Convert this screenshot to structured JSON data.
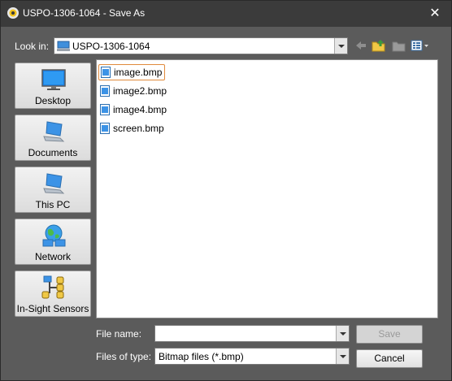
{
  "window": {
    "title": "USPO-1306-1064 - Save As",
    "close_glyph": "✕"
  },
  "toolbar": {
    "look_in_label": "Look in:",
    "look_in_value": "USPO-1306-1064",
    "icons": [
      "back-arrow-icon",
      "up-folder-icon",
      "new-folder-icon",
      "view-menu-icon"
    ]
  },
  "places": [
    {
      "label": "Desktop",
      "icon": "desktop-icon"
    },
    {
      "label": "Documents",
      "icon": "documents-computer-icon"
    },
    {
      "label": "This PC",
      "icon": "this-pc-icon"
    },
    {
      "label": "Network",
      "icon": "network-icon"
    },
    {
      "label": "In-Sight Sensors",
      "icon": "in-sight-sensors-icon"
    }
  ],
  "files": [
    {
      "name": "image.bmp",
      "selected": true
    },
    {
      "name": "image2.bmp",
      "selected": false
    },
    {
      "name": "image4.bmp",
      "selected": false
    },
    {
      "name": "screen.bmp",
      "selected": false
    }
  ],
  "bottom": {
    "file_name_label": "File name:",
    "file_name_value": "",
    "files_of_type_label": "Files of type:",
    "files_of_type_value": "Bitmap files (*.bmp)",
    "save_label": "Save",
    "cancel_label": "Cancel"
  },
  "colors": {
    "title_bg": "#3b3b3b",
    "dialog_bg": "#5b5b5b",
    "selection_border": "#e08a3c"
  }
}
